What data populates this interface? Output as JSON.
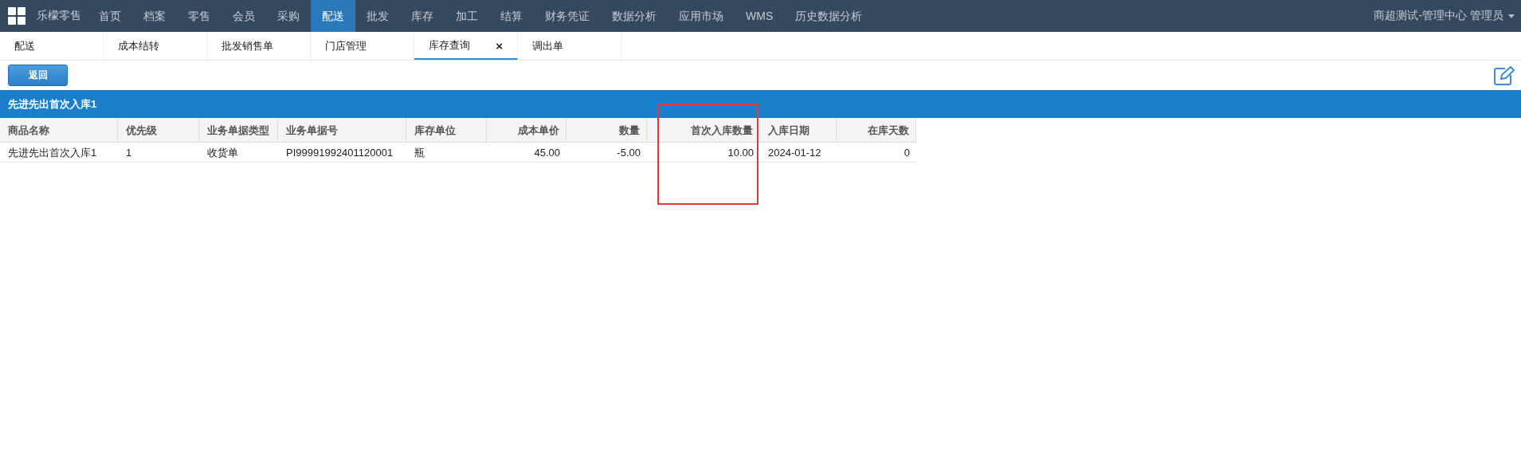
{
  "nav": {
    "brand": "乐檬零售",
    "items": [
      {
        "label": "首页",
        "selected": false
      },
      {
        "label": "档案",
        "selected": false
      },
      {
        "label": "零售",
        "selected": false
      },
      {
        "label": "会员",
        "selected": false
      },
      {
        "label": "采购",
        "selected": false
      },
      {
        "label": "配送",
        "selected": true
      },
      {
        "label": "批发",
        "selected": false
      },
      {
        "label": "库存",
        "selected": false
      },
      {
        "label": "加工",
        "selected": false
      },
      {
        "label": "结算",
        "selected": false
      },
      {
        "label": "财务凭证",
        "selected": false
      },
      {
        "label": "数据分析",
        "selected": false
      },
      {
        "label": "应用市场",
        "selected": false
      },
      {
        "label": "WMS",
        "selected": false
      },
      {
        "label": "历史数据分析",
        "selected": false
      }
    ],
    "user": "商超测试-管理中心 管理员"
  },
  "tabs": [
    {
      "label": "配送",
      "selected": false
    },
    {
      "label": "成本结转",
      "selected": false
    },
    {
      "label": "批发销售单",
      "selected": false
    },
    {
      "label": "门店管理",
      "selected": false
    },
    {
      "label": "库存查询",
      "selected": true,
      "close": "×"
    },
    {
      "label": "调出单",
      "selected": false
    }
  ],
  "back_button": "返回",
  "panel": {
    "title": "先进先出首次入库1",
    "columns": [
      {
        "label": "商品名称",
        "numeric": false
      },
      {
        "label": "优先级",
        "numeric": false
      },
      {
        "label": "业务单据类型",
        "numeric": false
      },
      {
        "label": "业务单据号",
        "numeric": false
      },
      {
        "label": "库存单位",
        "numeric": false
      },
      {
        "label": "成本单价",
        "numeric": true
      },
      {
        "label": "数量",
        "numeric": true
      },
      {
        "label": "首次入库数量",
        "numeric": true
      },
      {
        "label": "入库日期",
        "numeric": false
      },
      {
        "label": "在库天数",
        "numeric": true
      }
    ],
    "rows": [
      [
        "先进先出首次入库1",
        "1",
        "收货单",
        "PI99991992401120001",
        "瓶",
        "45.00",
        "-5.00",
        "10.00",
        "2024-01-12",
        "0"
      ]
    ]
  }
}
